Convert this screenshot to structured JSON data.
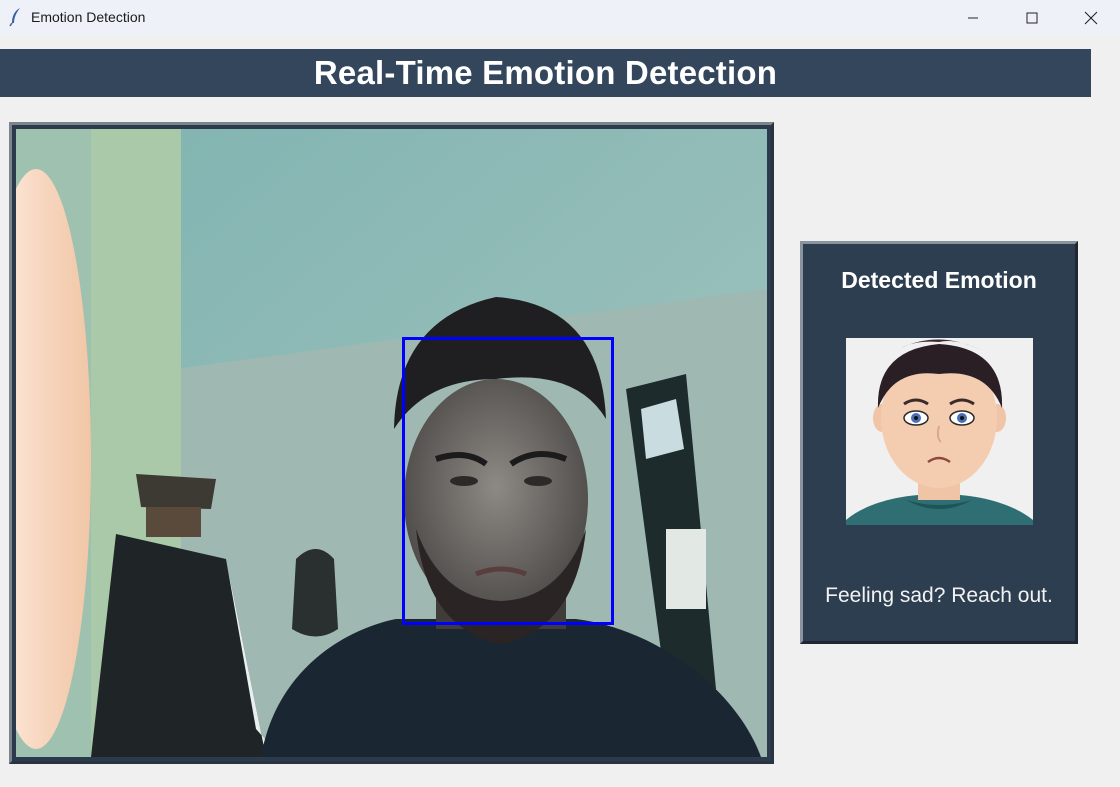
{
  "window": {
    "title": "Emotion Detection",
    "controls": [
      "minimize-icon",
      "maximize-icon",
      "close-icon"
    ]
  },
  "header": {
    "title": "Real-Time Emotion Detection",
    "background": "#33465c"
  },
  "video": {
    "face_box_color": "#0000ff"
  },
  "panel": {
    "title": "Detected Emotion",
    "emoji_label": "sad",
    "message": "Feeling sad? Reach out.",
    "background": "#2d3e50"
  }
}
